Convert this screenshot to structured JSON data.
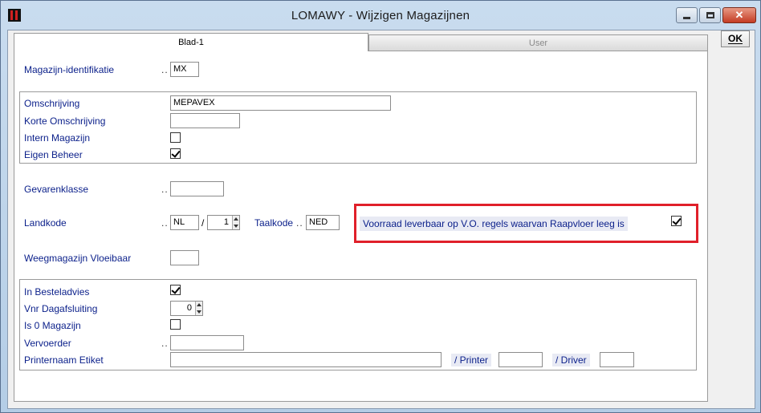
{
  "window": {
    "title": "LOMAWY - Wijzigen Magazijnen",
    "close_glyph": "✕"
  },
  "tabs": [
    {
      "label": "Blad-1"
    },
    {
      "label": "User"
    }
  ],
  "ok_label": "OK",
  "form": {
    "magazijn_id": {
      "label": "Magazijn-identifikatie",
      "value": "MX"
    },
    "omschrijving": {
      "label": "Omschrijving",
      "value": "MEPAVEX"
    },
    "korte_omschrijving": {
      "label": "Korte Omschrijving",
      "value": ""
    },
    "intern_magazijn": {
      "label": "Intern Magazijn",
      "checked": false
    },
    "eigen_beheer": {
      "label": "Eigen Beheer",
      "checked": true
    },
    "gevarenklasse": {
      "label": "Gevarenklasse",
      "value": ""
    },
    "landkode": {
      "label": "Landkode",
      "value": "NL",
      "sep": "/",
      "spin_value": "1"
    },
    "taalkode": {
      "label": "Taalkode",
      "value": "NED"
    },
    "voorraad": {
      "label": "Voorraad leverbaar op V.O. regels waarvan Raapvloer leeg is",
      "checked": true
    },
    "weegmagazijn": {
      "label": "Weegmagazijn Vloeibaar",
      "value": ""
    },
    "in_besteladvies": {
      "label": "In Besteladvies",
      "checked": true
    },
    "vnr_dagafsluiting": {
      "label": "Vnr Dagafsluiting",
      "value": "0"
    },
    "is0_magazijn": {
      "label": "Is 0 Magazijn",
      "checked": false
    },
    "vervoerder": {
      "label": "Vervoerder",
      "value": ""
    },
    "printernaam": {
      "label": "Printernaam Etiket",
      "value": ""
    },
    "printer": {
      "label": "/ Printer",
      "value": ""
    },
    "driver": {
      "label": "/ Driver",
      "value": ""
    }
  },
  "dots": "..",
  "colors": {
    "label": "#0a1f8a",
    "highlight": "#e0202a"
  }
}
